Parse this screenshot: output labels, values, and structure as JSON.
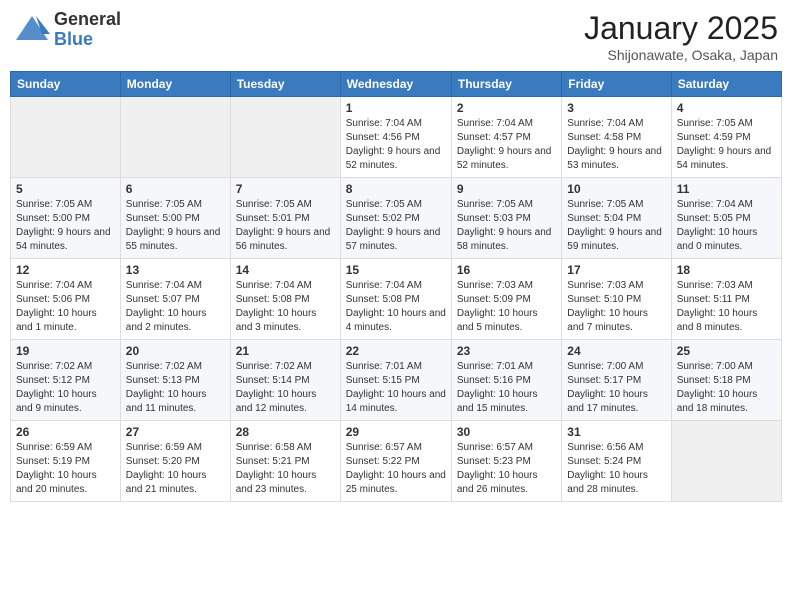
{
  "header": {
    "logo_general": "General",
    "logo_blue": "Blue",
    "month_title": "January 2025",
    "subtitle": "Shijonawate, Osaka, Japan"
  },
  "weekdays": [
    "Sunday",
    "Monday",
    "Tuesday",
    "Wednesday",
    "Thursday",
    "Friday",
    "Saturday"
  ],
  "weeks": [
    [
      {
        "day": "",
        "info": ""
      },
      {
        "day": "",
        "info": ""
      },
      {
        "day": "",
        "info": ""
      },
      {
        "day": "1",
        "info": "Sunrise: 7:04 AM\nSunset: 4:56 PM\nDaylight: 9 hours and 52 minutes."
      },
      {
        "day": "2",
        "info": "Sunrise: 7:04 AM\nSunset: 4:57 PM\nDaylight: 9 hours and 52 minutes."
      },
      {
        "day": "3",
        "info": "Sunrise: 7:04 AM\nSunset: 4:58 PM\nDaylight: 9 hours and 53 minutes."
      },
      {
        "day": "4",
        "info": "Sunrise: 7:05 AM\nSunset: 4:59 PM\nDaylight: 9 hours and 54 minutes."
      }
    ],
    [
      {
        "day": "5",
        "info": "Sunrise: 7:05 AM\nSunset: 5:00 PM\nDaylight: 9 hours and 54 minutes."
      },
      {
        "day": "6",
        "info": "Sunrise: 7:05 AM\nSunset: 5:00 PM\nDaylight: 9 hours and 55 minutes."
      },
      {
        "day": "7",
        "info": "Sunrise: 7:05 AM\nSunset: 5:01 PM\nDaylight: 9 hours and 56 minutes."
      },
      {
        "day": "8",
        "info": "Sunrise: 7:05 AM\nSunset: 5:02 PM\nDaylight: 9 hours and 57 minutes."
      },
      {
        "day": "9",
        "info": "Sunrise: 7:05 AM\nSunset: 5:03 PM\nDaylight: 9 hours and 58 minutes."
      },
      {
        "day": "10",
        "info": "Sunrise: 7:05 AM\nSunset: 5:04 PM\nDaylight: 9 hours and 59 minutes."
      },
      {
        "day": "11",
        "info": "Sunrise: 7:04 AM\nSunset: 5:05 PM\nDaylight: 10 hours and 0 minutes."
      }
    ],
    [
      {
        "day": "12",
        "info": "Sunrise: 7:04 AM\nSunset: 5:06 PM\nDaylight: 10 hours and 1 minute."
      },
      {
        "day": "13",
        "info": "Sunrise: 7:04 AM\nSunset: 5:07 PM\nDaylight: 10 hours and 2 minutes."
      },
      {
        "day": "14",
        "info": "Sunrise: 7:04 AM\nSunset: 5:08 PM\nDaylight: 10 hours and 3 minutes."
      },
      {
        "day": "15",
        "info": "Sunrise: 7:04 AM\nSunset: 5:08 PM\nDaylight: 10 hours and 4 minutes."
      },
      {
        "day": "16",
        "info": "Sunrise: 7:03 AM\nSunset: 5:09 PM\nDaylight: 10 hours and 5 minutes."
      },
      {
        "day": "17",
        "info": "Sunrise: 7:03 AM\nSunset: 5:10 PM\nDaylight: 10 hours and 7 minutes."
      },
      {
        "day": "18",
        "info": "Sunrise: 7:03 AM\nSunset: 5:11 PM\nDaylight: 10 hours and 8 minutes."
      }
    ],
    [
      {
        "day": "19",
        "info": "Sunrise: 7:02 AM\nSunset: 5:12 PM\nDaylight: 10 hours and 9 minutes."
      },
      {
        "day": "20",
        "info": "Sunrise: 7:02 AM\nSunset: 5:13 PM\nDaylight: 10 hours and 11 minutes."
      },
      {
        "day": "21",
        "info": "Sunrise: 7:02 AM\nSunset: 5:14 PM\nDaylight: 10 hours and 12 minutes."
      },
      {
        "day": "22",
        "info": "Sunrise: 7:01 AM\nSunset: 5:15 PM\nDaylight: 10 hours and 14 minutes."
      },
      {
        "day": "23",
        "info": "Sunrise: 7:01 AM\nSunset: 5:16 PM\nDaylight: 10 hours and 15 minutes."
      },
      {
        "day": "24",
        "info": "Sunrise: 7:00 AM\nSunset: 5:17 PM\nDaylight: 10 hours and 17 minutes."
      },
      {
        "day": "25",
        "info": "Sunrise: 7:00 AM\nSunset: 5:18 PM\nDaylight: 10 hours and 18 minutes."
      }
    ],
    [
      {
        "day": "26",
        "info": "Sunrise: 6:59 AM\nSunset: 5:19 PM\nDaylight: 10 hours and 20 minutes."
      },
      {
        "day": "27",
        "info": "Sunrise: 6:59 AM\nSunset: 5:20 PM\nDaylight: 10 hours and 21 minutes."
      },
      {
        "day": "28",
        "info": "Sunrise: 6:58 AM\nSunset: 5:21 PM\nDaylight: 10 hours and 23 minutes."
      },
      {
        "day": "29",
        "info": "Sunrise: 6:57 AM\nSunset: 5:22 PM\nDaylight: 10 hours and 25 minutes."
      },
      {
        "day": "30",
        "info": "Sunrise: 6:57 AM\nSunset: 5:23 PM\nDaylight: 10 hours and 26 minutes."
      },
      {
        "day": "31",
        "info": "Sunrise: 6:56 AM\nSunset: 5:24 PM\nDaylight: 10 hours and 28 minutes."
      },
      {
        "day": "",
        "info": ""
      }
    ]
  ]
}
